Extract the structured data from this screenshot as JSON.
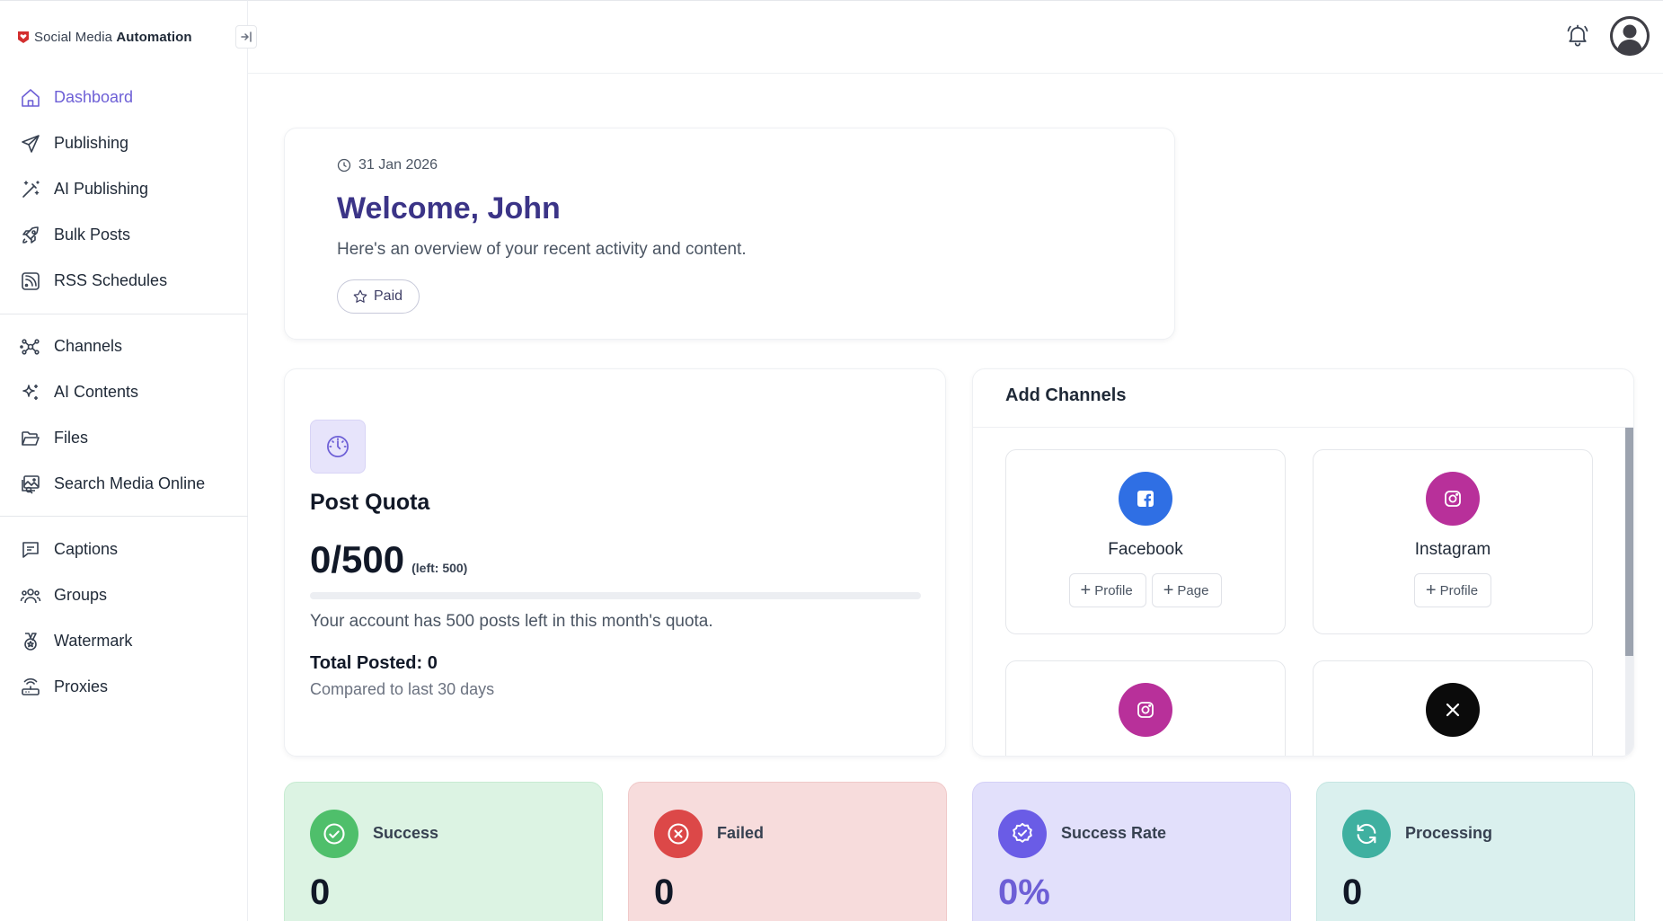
{
  "brand": {
    "name_prefix": "Social Media ",
    "name_bold": "Automation"
  },
  "sidebar": {
    "groups": [
      [
        {
          "label": "Dashboard",
          "icon": "home-icon",
          "active": true
        },
        {
          "label": "Publishing",
          "icon": "send-icon"
        },
        {
          "label": "AI Publishing",
          "icon": "magic-wand-icon"
        },
        {
          "label": "Bulk Posts",
          "icon": "rocket-icon"
        },
        {
          "label": "RSS Schedules",
          "icon": "rss-icon"
        }
      ],
      [
        {
          "label": "Channels",
          "icon": "network-icon"
        },
        {
          "label": "AI Contents",
          "icon": "sparkles-icon"
        },
        {
          "label": "Files",
          "icon": "folder-open-icon"
        },
        {
          "label": "Search Media Online",
          "icon": "images-search-icon"
        }
      ],
      [
        {
          "label": "Captions",
          "icon": "caption-message-icon"
        },
        {
          "label": "Groups",
          "icon": "users-group-icon"
        },
        {
          "label": "Watermark",
          "icon": "medal-icon"
        },
        {
          "label": "Proxies",
          "icon": "router-icon"
        }
      ]
    ]
  },
  "welcome": {
    "date": "31 Jan 2026",
    "title": "Welcome, John",
    "subtitle": "Here's an overview of your recent activity and content.",
    "plan_label": "Paid"
  },
  "quota": {
    "title": "Post Quota",
    "value": "0/500",
    "left": "(left: 500)",
    "progress_fraction": 0,
    "description": "Your account has 500 posts left in this month's quota.",
    "total_posted": "Total Posted: 0",
    "compared": "Compared to last 30 days"
  },
  "channels": {
    "title": "Add Channels",
    "items": [
      {
        "name": "Facebook",
        "icon": "facebook-icon",
        "color": "#2f6fe4",
        "buttons": [
          "Profile",
          "Page"
        ]
      },
      {
        "name": "Instagram",
        "icon": "instagram-icon",
        "color": "#b8309a",
        "buttons": [
          "Profile"
        ]
      },
      {
        "name": "",
        "icon": "instagram-icon",
        "color": "#b8309a",
        "buttons": []
      },
      {
        "name": "",
        "icon": "x-icon",
        "color": "#0b0b0b",
        "buttons": []
      }
    ]
  },
  "stats": [
    {
      "label": "Success",
      "value": "0",
      "bg": "#dcf3e3",
      "border": "#c7ebd2",
      "icon_bg": "#4fbf6b",
      "icon": "check-circle-icon",
      "value_color": "#111827"
    },
    {
      "label": "Failed",
      "value": "0",
      "bg": "#f7dcdc",
      "border": "#f0c9c9",
      "icon_bg": "#dc4848",
      "icon": "x-circle-icon",
      "value_color": "#111827"
    },
    {
      "label": "Success Rate",
      "value": "0%",
      "bg": "#e2e0fb",
      "border": "#d4d0f7",
      "icon_bg": "#6a5ce6",
      "icon": "badge-check-icon",
      "value_color": "#6d5fd6"
    },
    {
      "label": "Processing",
      "value": "0",
      "bg": "#daf0ee",
      "border": "#c5e6e2",
      "icon_bg": "#3fb0a0",
      "icon": "refresh-icon",
      "value_color": "#111827"
    }
  ],
  "colors": {
    "accent": "#6d5fd6",
    "welcome_title": "#3b3487"
  }
}
